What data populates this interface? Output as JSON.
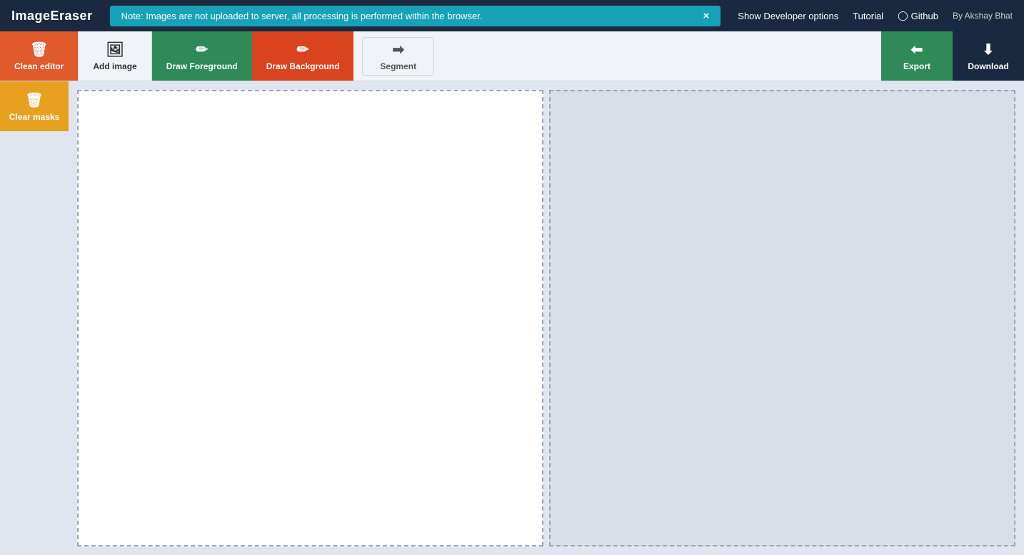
{
  "brand": {
    "name": "ImageEraser"
  },
  "notice": {
    "text": "Note: Images are not uploaded to server, all processing is performed within the browser.",
    "close_label": "×"
  },
  "nav": {
    "show_dev": "Show Developer options",
    "tutorial": "Tutorial",
    "github": "Github",
    "by": "By Akshay Bhat"
  },
  "toolbar": {
    "clean_editor": "Clean editor",
    "add_image": "Add image",
    "draw_foreground": "Draw Foreground",
    "draw_background": "Draw Background",
    "segment": "Segment",
    "export": "Export",
    "download": "Download"
  },
  "sidebar": {
    "clear_masks": "Clear masks"
  },
  "canvas": {
    "left_empty": "",
    "right_empty": ""
  }
}
